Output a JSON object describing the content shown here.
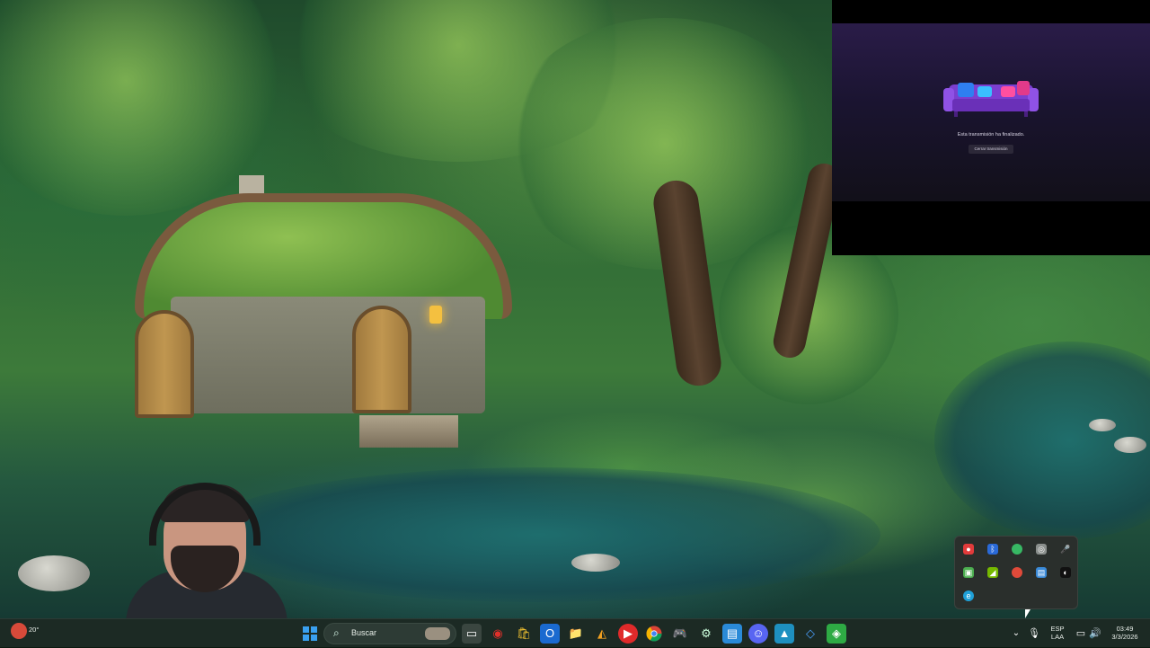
{
  "wallpaper": {
    "description_icon": "forest-hobbit-house-wallpaper"
  },
  "stream_overlay": {
    "message": "Esta transmisión ha finalizado.",
    "close_button": "Cerrar transmisión",
    "illustration": "couch-icon"
  },
  "webcam": {
    "icon": "webcam-feed"
  },
  "tray_popup": {
    "icons": [
      "red-record-icon",
      "bluetooth-icon",
      "green-circle-icon",
      "camera-app-icon",
      "red-mic-icon",
      "green-app-icon",
      "nvidia-icon",
      "chrome-variant-icon",
      "blue-app-icon",
      "dark-app-icon",
      "edge-variant-icon"
    ]
  },
  "taskbar": {
    "start_icon": "windows-start-icon",
    "search_placeholder": "Buscar",
    "apps": [
      "task-view-icon",
      "red-app-icon",
      "store-icon",
      "outlook-icon",
      "file-explorer-icon",
      "yellow-app-icon",
      "red-circle-app-icon",
      "chrome-icon",
      "controller-icon",
      "steam-icon",
      "notepad-icon",
      "discord-icon",
      "photos-icon",
      "vscode-icon",
      "green-app-icon"
    ],
    "language_top": "ESP",
    "language_bottom": "LAA",
    "time": "03:49",
    "date": "3/3/2026",
    "weather_partial": "20°"
  }
}
